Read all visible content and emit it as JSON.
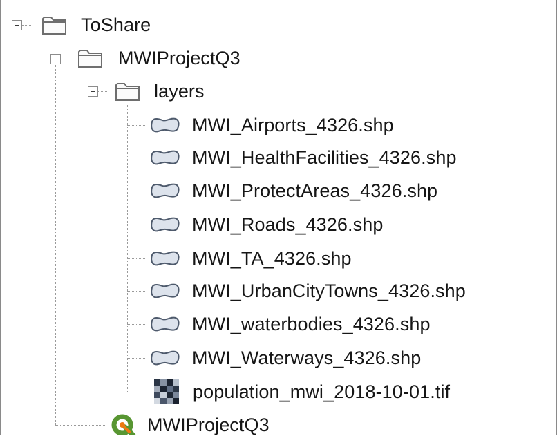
{
  "tree": {
    "root": {
      "label": "ToShare",
      "icon": "folder-icon"
    },
    "project_folder": {
      "label": "MWIProjectQ3",
      "icon": "folder-icon"
    },
    "layers_folder": {
      "label": "layers",
      "icon": "folder-icon"
    },
    "layers": [
      {
        "label": "MWI_Airports_4326.shp",
        "icon": "vector-layer-icon"
      },
      {
        "label": "MWI_HealthFacilities_4326.shp",
        "icon": "vector-layer-icon"
      },
      {
        "label": "MWI_ProtectAreas_4326.shp",
        "icon": "vector-layer-icon"
      },
      {
        "label": "MWI_Roads_4326.shp",
        "icon": "vector-layer-icon"
      },
      {
        "label": "MWI_TA_4326.shp",
        "icon": "vector-layer-icon"
      },
      {
        "label": "MWI_UrbanCityTowns_4326.shp",
        "icon": "vector-layer-icon"
      },
      {
        "label": "MWI_waterbodies_4326.shp",
        "icon": "vector-layer-icon"
      },
      {
        "label": "MWI_Waterways_4326.shp",
        "icon": "vector-layer-icon"
      },
      {
        "label": "population_mwi_2018-10-01.tif",
        "icon": "raster-layer-icon"
      }
    ],
    "project_file": {
      "label": "MWIProjectQ3",
      "icon": "qgis-project-icon"
    }
  },
  "colors": {
    "qgis_green": "#589632",
    "qgis_yellow": "#ee7913",
    "folder_stroke": "#6e6e6e",
    "vector_fill": "#dde3ec",
    "vector_stroke": "#4e5a6c"
  }
}
